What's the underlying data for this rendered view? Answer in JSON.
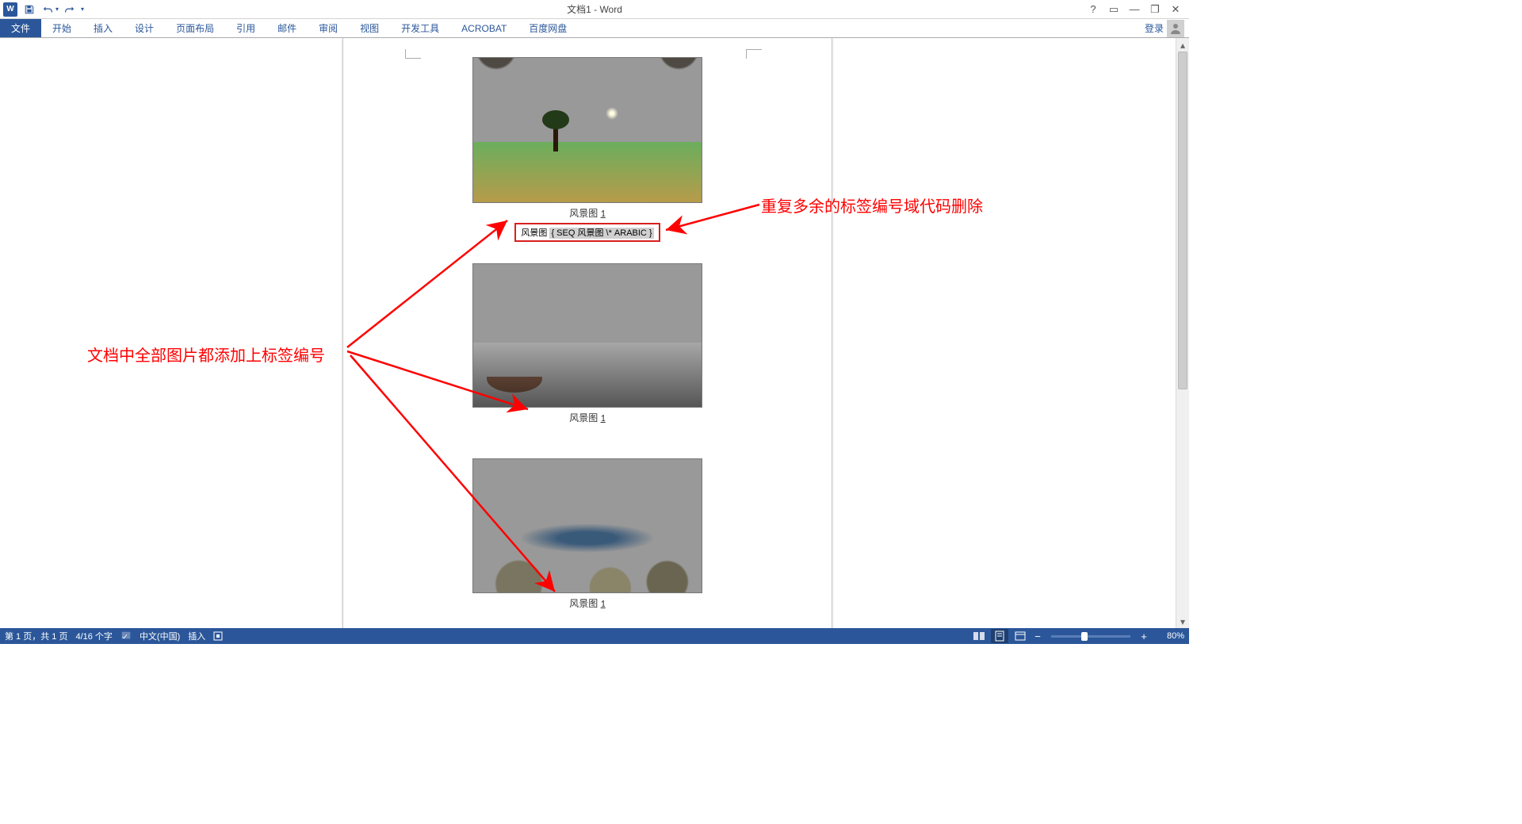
{
  "title": "文档1 - Word",
  "qat": {
    "save": "save",
    "undo": "undo",
    "redo": "redo"
  },
  "window": {
    "help": "?",
    "ribbon_opts": "▭",
    "min": "—",
    "restore": "❐",
    "close": "✕"
  },
  "tabs": {
    "file": "文件",
    "home": "开始",
    "insert": "插入",
    "design": "设计",
    "layout": "页面布局",
    "references": "引用",
    "mailings": "邮件",
    "review": "审阅",
    "view": "视图",
    "developer": "开发工具",
    "acrobat": "ACROBAT",
    "baidu": "百度网盘"
  },
  "signin": "登录",
  "captions": {
    "label": "风景图",
    "c1_num": "1",
    "field_prefix": "风景图 ",
    "field_code": "{ SEQ 风景图 \\* ARABIC }",
    "c2_num": "1",
    "c3_num": "1"
  },
  "annotations": {
    "left": "文档中全部图片都添加上标签编号",
    "right": "重复多余的标签编号域代码删除"
  },
  "status": {
    "page": "第 1 页，共 1 页",
    "words": "4/16 个字",
    "lang": "中文(中国)",
    "mode": "插入",
    "zoom": "80%"
  }
}
